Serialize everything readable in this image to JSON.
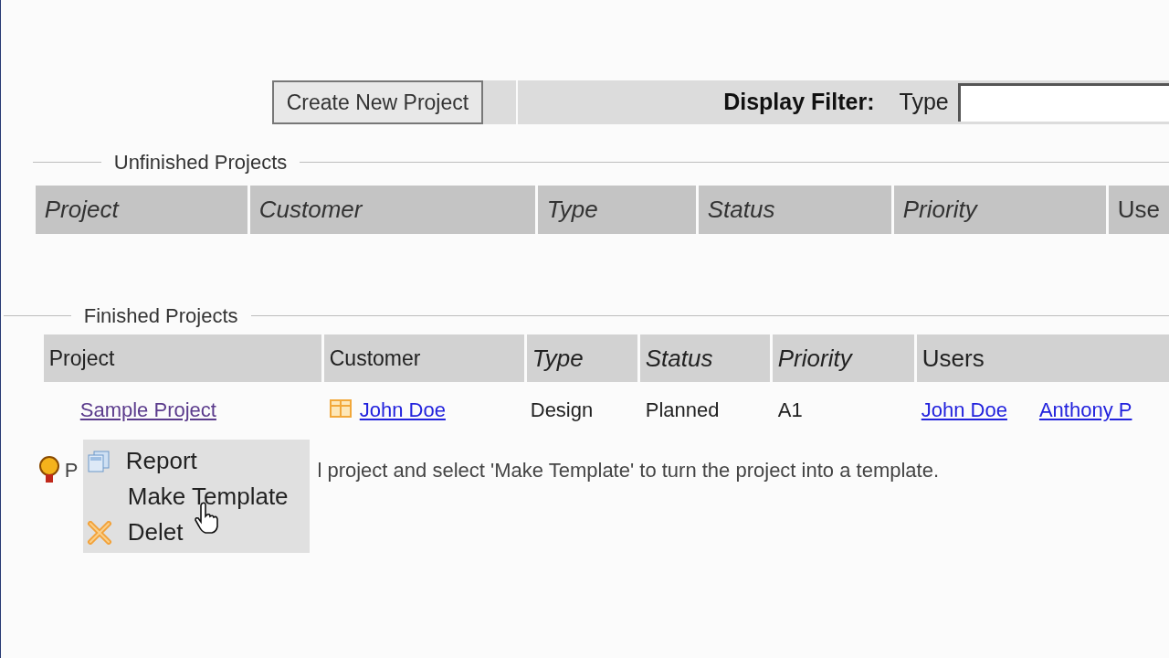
{
  "toolbar": {
    "create_button": "Create New Project",
    "filter_label": "Display Filter:",
    "type_label": "Type"
  },
  "unfinished": {
    "title": "Unfinished Projects",
    "columns": [
      {
        "label": "Project",
        "italic": true
      },
      {
        "label": "Customer",
        "italic": true
      },
      {
        "label": "Type",
        "italic": true
      },
      {
        "label": "Status",
        "italic": true
      },
      {
        "label": "Priority",
        "italic": true
      },
      {
        "label": "Use",
        "italic": false
      }
    ]
  },
  "finished": {
    "title": "Finished Projects",
    "columns": [
      {
        "label": "Project",
        "italic": false
      },
      {
        "label": "Customer",
        "italic": false
      },
      {
        "label": "Type",
        "italic": true
      },
      {
        "label": "Status",
        "italic": true
      },
      {
        "label": "Priority",
        "italic": true
      },
      {
        "label": "Users",
        "italic": false
      }
    ],
    "rows": [
      {
        "project": "Sample Project",
        "customer": "John Doe",
        "type": "Design",
        "status": "Planned",
        "priority": "A1",
        "users": [
          "John Doe",
          "Anthony P"
        ]
      }
    ]
  },
  "context_menu": [
    {
      "kind": "report",
      "label": "Report"
    },
    {
      "kind": "template",
      "label": "Make Template"
    },
    {
      "kind": "delete",
      "label": "Delet"
    }
  ],
  "hint": {
    "start": "P",
    "rest": "l project and select 'Make Template' to turn the project into a template."
  }
}
